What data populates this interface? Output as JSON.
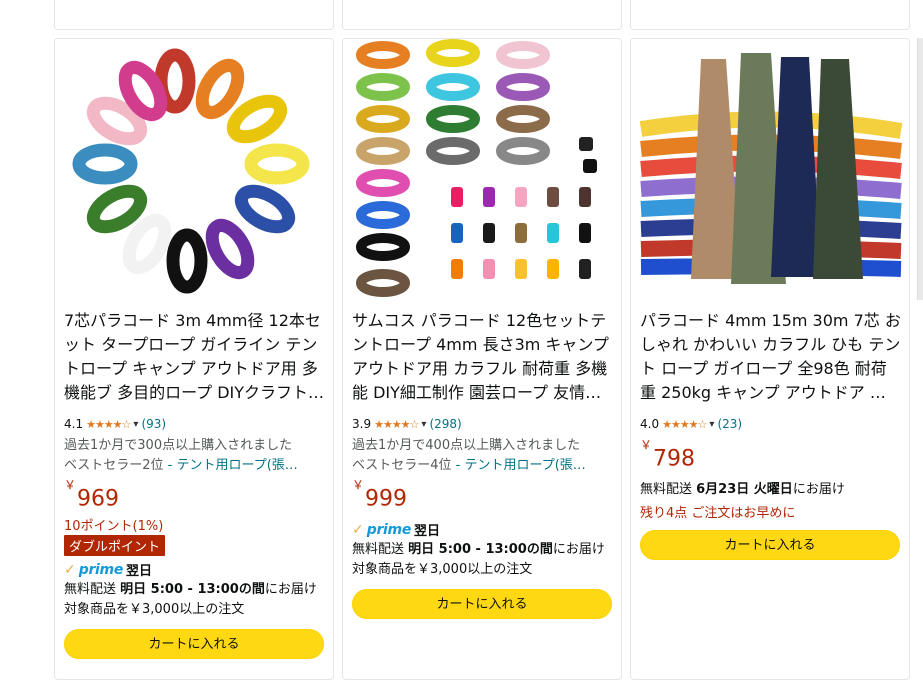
{
  "products": [
    {
      "title": "7芯パラコード 3m 4mm径 12本セット タープロープ ガイライン テントロープ キャンプ アウトドア用 多機能ブ 多目的ロープ DIYクラフト…",
      "rating": "4.1",
      "stars": "★★★★☆",
      "reviews": "(93)",
      "bought": "過去1か月で300点以上購入されました",
      "bestseller": "ベストセラー2位",
      "bestseller_link": "- テント用ロープ(張…",
      "currency": "￥",
      "price": "969",
      "points": "10ポイント(1%)",
      "badge": "ダブルポイント",
      "prime_label": "prime",
      "prime_day": "翌日",
      "ship_prefix": "無料配送 ",
      "ship_date": "明日 5:00 - 13:00の間",
      "ship_suffix": "にお届け 対象商品を￥3,000以上の注文",
      "cart": "カートに入れる"
    },
    {
      "title": "サムコス パラコード 12色セットテントロープ 4mm 長さ3m キャンプ アウトドア用 カラフル 耐荷重 多機能 DIY細工制作 園芸ロープ 友情…",
      "rating": "3.9",
      "stars": "★★★★☆",
      "reviews": "(298)",
      "bought": "過去1か月で400点以上購入されました",
      "bestseller": "ベストセラー4位",
      "bestseller_link": "- テント用ロープ(張…",
      "currency": "￥",
      "price": "999",
      "prime_label": "prime",
      "prime_day": "翌日",
      "ship_prefix": "無料配送 ",
      "ship_date": "明日 5:00 - 13:00の間",
      "ship_suffix": "にお届け 対象商品を￥3,000以上の注文",
      "cart": "カートに入れる"
    },
    {
      "title": "パラコード 4mm 15m 30m 7芯 おしゃれ かわいい カラフル ひも テント ロープ ガイロープ 全98色 耐荷重 250kg キャンプ アウトドア …",
      "rating": "4.0",
      "stars": "★★★★☆",
      "reviews": "(23)",
      "currency": "￥",
      "price": "798",
      "ship_prefix": "無料配送 ",
      "ship_date": "6月23日 火曜日",
      "ship_suffix": "にお届け",
      "stock": "残り4点 ご注文はお早めに",
      "cart": "カートに入れる"
    }
  ],
  "colors": {
    "price": "#b12704",
    "link": "#007185",
    "cart": "#ffd814",
    "star": "#de7921",
    "prime": "#1399d8"
  }
}
